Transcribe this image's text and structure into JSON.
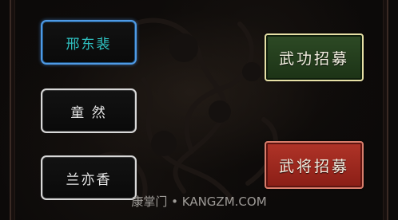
{
  "name_options": [
    {
      "label": "邢东裴",
      "selected": true
    },
    {
      "label": "童 然",
      "selected": false
    },
    {
      "label": "兰亦香",
      "selected": false
    }
  ],
  "recruit": {
    "wugong": "武功招募",
    "wujiang": "武将招募"
  },
  "watermark": "康掌门 • KANGZM.COM",
  "colors": {
    "selected_border": "#4f9be6",
    "selected_text": "#2fc2c2",
    "wugong_bg": "#2d4a25",
    "wujiang_bg": "#b03428"
  }
}
